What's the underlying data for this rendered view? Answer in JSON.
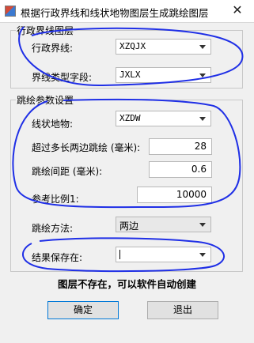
{
  "window": {
    "title": "根据行政界线和线状地物图层生成跳绘图层",
    "close_glyph": "✕"
  },
  "group_admin": {
    "legend": "行政界线图层",
    "admin_line_label": "行政界线:",
    "admin_line_value": "XZQJX",
    "line_type_label": "界线类型字段:",
    "line_type_value": "JXLX"
  },
  "group_params": {
    "legend": "跳绘参数设置",
    "linear_feature_label": "线状地物:",
    "linear_feature_value": "XZDW",
    "over_length_label": "超过多长两边跳绘 (毫米):",
    "over_length_value": "28",
    "interval_label": "跳绘间距 (毫米):",
    "interval_value": "0.6",
    "scale_label": "参考比例1:",
    "scale_value": "10000",
    "method_label": "跳绘方法:",
    "method_value": "两边",
    "save_label": "结果保存在:",
    "save_value": ""
  },
  "hint": "图层不存在，可以软件自动创建",
  "buttons": {
    "ok": "确定",
    "exit": "退出"
  },
  "colors": {
    "annotation": "#1f2fe6"
  }
}
